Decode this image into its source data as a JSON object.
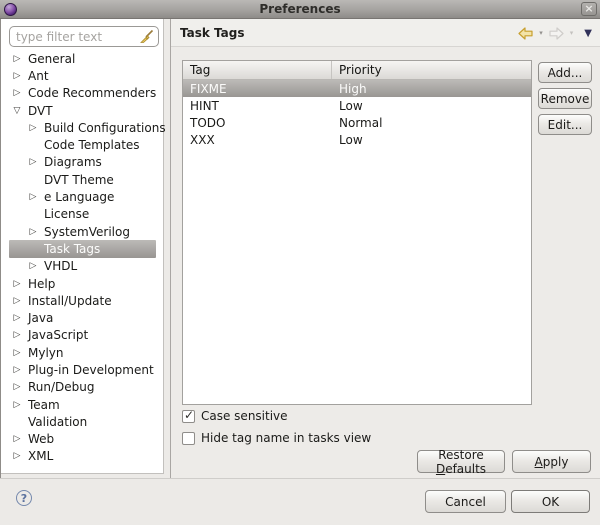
{
  "window": {
    "title": "Preferences",
    "close_glyph": "×"
  },
  "sidebar": {
    "filter_placeholder": "type filter text",
    "items": [
      {
        "label": "General",
        "depth": 0,
        "arrow": "collapsed",
        "selected": false
      },
      {
        "label": "Ant",
        "depth": 0,
        "arrow": "collapsed",
        "selected": false
      },
      {
        "label": "Code Recommenders",
        "depth": 0,
        "arrow": "collapsed",
        "selected": false
      },
      {
        "label": "DVT",
        "depth": 0,
        "arrow": "expanded",
        "selected": false
      },
      {
        "label": "Build Configurations",
        "depth": 1,
        "arrow": "collapsed",
        "selected": false
      },
      {
        "label": "Code Templates",
        "depth": 1,
        "arrow": "none",
        "selected": false
      },
      {
        "label": "Diagrams",
        "depth": 1,
        "arrow": "collapsed",
        "selected": false
      },
      {
        "label": "DVT Theme",
        "depth": 1,
        "arrow": "none",
        "selected": false
      },
      {
        "label": "e Language",
        "depth": 1,
        "arrow": "collapsed",
        "selected": false
      },
      {
        "label": "License",
        "depth": 1,
        "arrow": "none",
        "selected": false
      },
      {
        "label": "SystemVerilog",
        "depth": 1,
        "arrow": "collapsed",
        "selected": false
      },
      {
        "label": "Task Tags",
        "depth": 1,
        "arrow": "none",
        "selected": true
      },
      {
        "label": "VHDL",
        "depth": 1,
        "arrow": "collapsed",
        "selected": false
      },
      {
        "label": "Help",
        "depth": 0,
        "arrow": "collapsed",
        "selected": false
      },
      {
        "label": "Install/Update",
        "depth": 0,
        "arrow": "collapsed",
        "selected": false
      },
      {
        "label": "Java",
        "depth": 0,
        "arrow": "collapsed",
        "selected": false
      },
      {
        "label": "JavaScript",
        "depth": 0,
        "arrow": "collapsed",
        "selected": false
      },
      {
        "label": "Mylyn",
        "depth": 0,
        "arrow": "collapsed",
        "selected": false
      },
      {
        "label": "Plug-in Development",
        "depth": 0,
        "arrow": "collapsed",
        "selected": false
      },
      {
        "label": "Run/Debug",
        "depth": 0,
        "arrow": "collapsed",
        "selected": false
      },
      {
        "label": "Team",
        "depth": 0,
        "arrow": "collapsed",
        "selected": false
      },
      {
        "label": "Validation",
        "depth": 0,
        "arrow": "none",
        "selected": false
      },
      {
        "label": "Web",
        "depth": 0,
        "arrow": "collapsed",
        "selected": false
      },
      {
        "label": "XML",
        "depth": 0,
        "arrow": "collapsed",
        "selected": false
      }
    ],
    "expander_glyphs": {
      "collapsed": "▷",
      "expanded": "▽"
    }
  },
  "header": {
    "title": "Task Tags",
    "back_chevron": "▾",
    "forward_chevron": "▾",
    "view_menu_glyph": "▼"
  },
  "table": {
    "columns": [
      "Tag",
      "Priority"
    ],
    "rows": [
      {
        "tag": "FIXME",
        "priority": "High",
        "selected": true
      },
      {
        "tag": "HINT",
        "priority": "Low",
        "selected": false
      },
      {
        "tag": "TODO",
        "priority": "Normal",
        "selected": false
      },
      {
        "tag": "XXX",
        "priority": "Low",
        "selected": false
      }
    ]
  },
  "side_buttons": [
    {
      "label": "Add..."
    },
    {
      "label": "Remove"
    },
    {
      "label": "Edit..."
    }
  ],
  "checkboxes": [
    {
      "label": "Case sensitive",
      "checked": true,
      "check_glyph": "✓"
    },
    {
      "label": "Hide tag name in tasks view",
      "checked": false,
      "check_glyph": "✓"
    }
  ],
  "action_buttons": {
    "restore": {
      "pre": "Restore ",
      "key": "D",
      "rest": "efaults"
    },
    "apply": {
      "pre": "",
      "key": "A",
      "rest": "pply"
    }
  },
  "footer": {
    "help": "?",
    "cancel": "Cancel",
    "ok": "OK"
  },
  "colors": {
    "titlebar_top": "#bab8b5",
    "titlebar_bottom": "#8e8b88",
    "selection_top": "#bcbab7",
    "selection_bottom": "#989592",
    "panel_bg": "#edebe8",
    "back_arrow_gold": "#c79f2e",
    "menu_triangle": "#31315a",
    "help_blue": "#5a719e"
  }
}
